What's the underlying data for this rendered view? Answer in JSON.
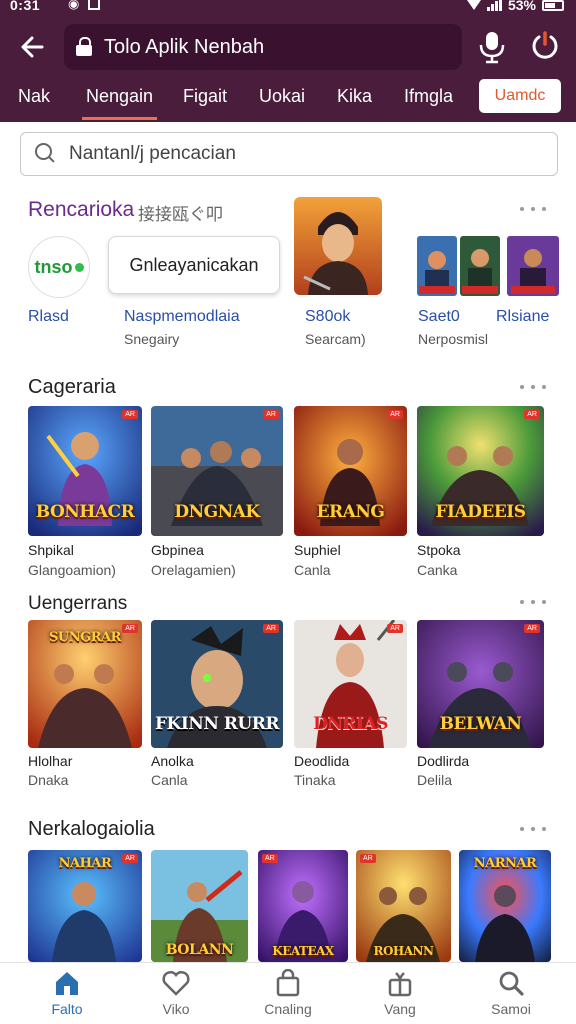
{
  "status": {
    "time": "0:31",
    "battery": "53%"
  },
  "header": {
    "url_text": "Tolo Aplik Nenbah",
    "tabs": [
      "Nak",
      "Nengain",
      "Figait",
      "Uokai",
      "Kika",
      "Ifmgla"
    ],
    "active_tab": "Nengain",
    "cta_label": "Uamdc"
  },
  "search": {
    "placeholder": "Nantanl/j pencacian"
  },
  "recommend": {
    "title": "Rencarioka",
    "subtitle": "接接瓯ぐ叩",
    "badge_text": "tnso",
    "pill_label": "Gnleayanicakan",
    "labels": [
      {
        "top": "Rlasd",
        "bottom": ""
      },
      {
        "top": "Naspmemodlaia",
        "bottom": "Snegairy"
      },
      {
        "top": "S80ok",
        "bottom": "Searcam)"
      },
      {
        "top": "Saet0",
        "bottom": "Nerposmisl"
      },
      {
        "top": "Rlsiane",
        "bottom": ""
      }
    ]
  },
  "sections": [
    {
      "title": "Cageraria",
      "cards": [
        {
          "art": "BONHACR",
          "name": "Shpikal",
          "sub": "Glangoamion)"
        },
        {
          "art": "DNGNAK",
          "name": "Gbpinea",
          "sub": "Orelagamien)"
        },
        {
          "art": "ERANG",
          "name": "Suphiel",
          "sub": "Canla"
        },
        {
          "art": "FIADEEIS",
          "name": "Stpoka",
          "sub": "Canka"
        }
      ]
    },
    {
      "title": "Uengerrans",
      "cards": [
        {
          "art": "SUNGRAR",
          "name": "Hlolhar",
          "sub": "Dnaka"
        },
        {
          "art": "FKINN RURR",
          "name": "Anolka",
          "sub": "Canla"
        },
        {
          "art": "DNRIAS",
          "name": "Deodlida",
          "sub": "Tinaka"
        },
        {
          "art": "BELWAN",
          "name": "Dodlirda",
          "sub": "Delila"
        }
      ]
    },
    {
      "title": "Nerkalogaiolia",
      "cards": [
        {
          "art": "NAHAR",
          "name": "",
          "sub": ""
        },
        {
          "art": "BOLANN",
          "name": "",
          "sub": ""
        },
        {
          "art": "KEATEAX",
          "name": "",
          "sub": ""
        },
        {
          "art": "ROHANN",
          "name": "",
          "sub": ""
        },
        {
          "art": "NARNAR",
          "name": "",
          "sub": ""
        }
      ]
    }
  ],
  "bottom_nav": [
    {
      "label": "Falto",
      "icon": "home-icon",
      "active": true
    },
    {
      "label": "Viko",
      "icon": "heart-icon",
      "active": false
    },
    {
      "label": "Cnaling",
      "icon": "bag-icon",
      "active": false
    },
    {
      "label": "Vang",
      "icon": "gift-icon",
      "active": false
    },
    {
      "label": "Samoi",
      "icon": "search-icon",
      "active": false
    }
  ],
  "colors": {
    "header_bg": "#4a1d3c",
    "accent": "#e4572e",
    "link_blue": "#2a4fa8",
    "active_nav": "#2a6fb0"
  }
}
